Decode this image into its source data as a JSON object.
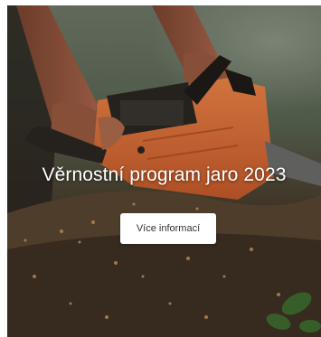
{
  "banner": {
    "title": "Věrnostní program jaro 2023",
    "cta_label": "Více informací",
    "photo_subject": "chainsaw-cutting-wood",
    "colors": {
      "chainsaw_body": "#e0703a",
      "text": "#ffffff",
      "button_bg": "#ffffff",
      "button_text": "#333333"
    }
  }
}
